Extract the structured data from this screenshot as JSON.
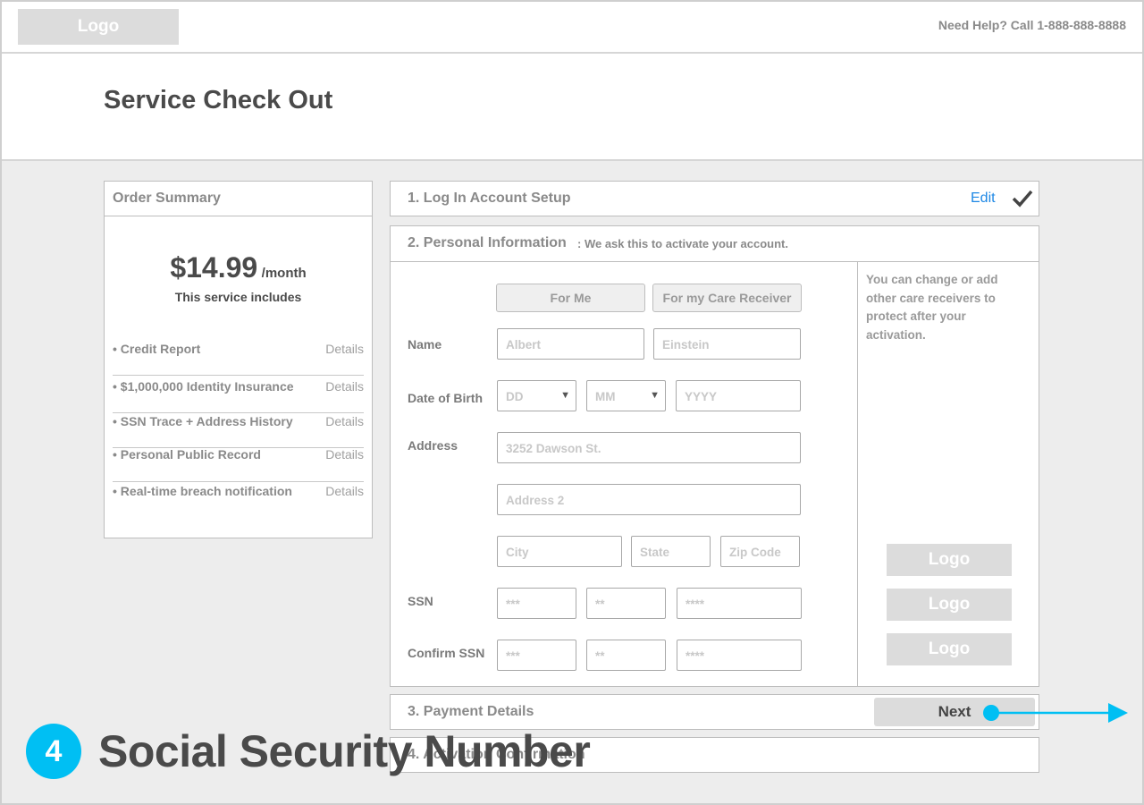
{
  "header": {
    "logo": "Logo",
    "help_text": "Need Help? Call 1-888-888-8888"
  },
  "page_title": "Service Check Out",
  "order_summary": {
    "heading": "Order Summary",
    "price": "$14.99",
    "per": "/month",
    "includes": "This service includes",
    "items": [
      {
        "label": "• Credit Report",
        "details": "Details"
      },
      {
        "label": "• $1,000,000 Identity Insurance",
        "details": "Details"
      },
      {
        "label": "• SSN Trace + Address History",
        "details": "Details"
      },
      {
        "label": "• Personal Public Record",
        "details": "Details"
      },
      {
        "label": "• Real-time breach notification",
        "details": "Details"
      }
    ]
  },
  "steps": {
    "step1": {
      "label": "1. Log In Account Setup",
      "edit": "Edit"
    },
    "step2": {
      "label": "2. Personal Information",
      "subtitle": ": We ask this to activate your account."
    },
    "step3": {
      "label": "3. Payment Details"
    },
    "step4": {
      "label": "4. Activation Confirmation"
    }
  },
  "personal_form": {
    "toggle_me": "For Me",
    "toggle_care": "For my Care Receiver",
    "labels": {
      "name": "Name",
      "dob": "Date of Birth",
      "address": "Address",
      "ssn": "SSN",
      "confirm_ssn": "Confirm SSN"
    },
    "placeholders": {
      "first_name": "Albert",
      "last_name": "Einstein",
      "dd": "DD",
      "mm": "MM",
      "yyyy": "YYYY",
      "address1": "3252 Dawson St.",
      "address2": "Address 2",
      "city": "City",
      "state": "State",
      "zip": "Zip Code",
      "ssn1": "***",
      "ssn2": "**",
      "ssn3": "****"
    },
    "side_text": "You can change or add other care receivers to protect after your activation.",
    "side_logos": [
      "Logo",
      "Logo",
      "Logo"
    ]
  },
  "next_button": "Next",
  "annotation": {
    "number": "4",
    "text": "Social Security Number"
  },
  "colors": {
    "accent": "#00bff3",
    "link": "#1e88e5"
  }
}
